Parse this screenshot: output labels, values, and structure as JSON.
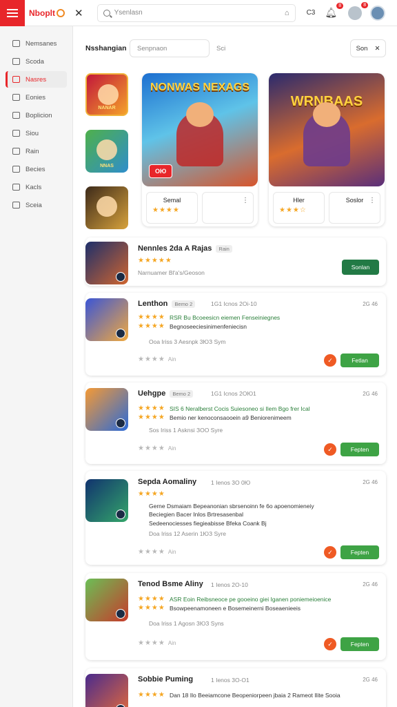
{
  "topbar": {
    "logo": "Nboplt",
    "search_placeholder": "Ysenlasn",
    "code": "C3",
    "notif_badge_1": "8",
    "notif_badge_2": "8"
  },
  "sidebar": {
    "items": [
      {
        "label": "Nemsanes",
        "active": false
      },
      {
        "label": "Scoda",
        "active": false
      },
      {
        "label": "Nasres",
        "active": true
      },
      {
        "label": "Eonies",
        "active": false
      },
      {
        "label": "Boplicion",
        "active": false
      },
      {
        "label": "Siou",
        "active": false
      },
      {
        "label": "Rain",
        "active": false
      },
      {
        "label": "Becies",
        "active": false
      },
      {
        "label": "Kacls",
        "active": false
      },
      {
        "label": "Sceia",
        "active": false
      }
    ]
  },
  "filter": {
    "title": "Nsshangian",
    "input_placeholder": "Senpnaon",
    "tag": "Sci",
    "chip": "Son"
  },
  "thumbnails": [
    {
      "label": "NANAR"
    },
    {
      "label": "NNAS"
    },
    {
      "label": ""
    }
  ],
  "featured": [
    {
      "art_title": "NONWAS NEXAGS",
      "price": "ОЮ",
      "box1_name": "Semal",
      "box1_stars": "★★★★",
      "box2_name": ""
    },
    {
      "art_title": "WRNBAAS",
      "price": "",
      "box1_name": "Hler",
      "box1_stars": "★★★☆",
      "box2_name": "Soslor"
    }
  ],
  "list": [
    {
      "title": "Nennles 2da A Rajas",
      "tag": "Rain",
      "stars": "★★★★★",
      "sub": "Narnuamer  Bl'a's/Geoson",
      "button": "Sonlan"
    },
    {
      "title": "Lenthon",
      "tag": "Bemo 2",
      "meta": "1G1 Icnos 2Oi-10",
      "time": "2G 46",
      "line1": "RSR Bu Bcoeesicn eiemen  Fenseiniegnes",
      "line2": "Begnoseeciesinimenfeniecisn",
      "info": "Ooa Iriss   3 Aesnpk     3ЮЗ Sym",
      "grey": "Ain",
      "button": "Fetlan"
    },
    {
      "title": "Uehgpe",
      "tag": "Bemo 2",
      "meta": "1G1 Icnos 2OЮ1",
      "time": "2G 46",
      "line1": "SIS 6 Neralberst Cocis  Suiesoneo si Ilem Bgo frer Ical",
      "line2": "Bemio ner kenoconsaooein a9 Beniorenimeem",
      "info": "Sos Iriss   1 Asknsi     ЗOO Syre",
      "grey": "Ain",
      "button": "Fepten"
    },
    {
      "title": "Sepda Aomaliny",
      "tag": "",
      "meta": "1 Ienos 3O 0Ю",
      "time": "2G 46",
      "line1": "Gerne Dsmaiam  Bepeanonian sbrsenoinn fe 6o apoenomieneiy",
      "line2": "Beciegien Bacer Inlos Brtresasenbal",
      "line3": "Sedeenociesses  fiegieabisse Bfeka Coank Bj",
      "info": "Doa Iriss  12 Aserin    1ЮЗ Syre",
      "grey": "Ain",
      "button": "Fepten"
    },
    {
      "title": "Tenod Bsme Aliny",
      "tag": "",
      "meta": "1 Ienos 2O-10",
      "time": "2G 46",
      "line1": "ASR Eoin  Reibsneoce pe gooeino giei Iganen poniemeioenice",
      "line2": "Bsowpeenamoneen e Bosemeinerni Boseaenieeis",
      "info": "Doa Iriss   1 Agosn    3ЮЗ Syns",
      "grey": "Ain",
      "button": "Fepten"
    },
    {
      "title": "Sobbie Puming",
      "tag": "",
      "meta": "1 Ienos 3O-O1",
      "time": "2G 46",
      "line1": "Dan 18 Ilo Beeiamcone Beopeniorpeen jbaia 2 Rameot Ilite Sooia",
      "line2": "",
      "info": "",
      "grey": "",
      "button": ""
    }
  ]
}
